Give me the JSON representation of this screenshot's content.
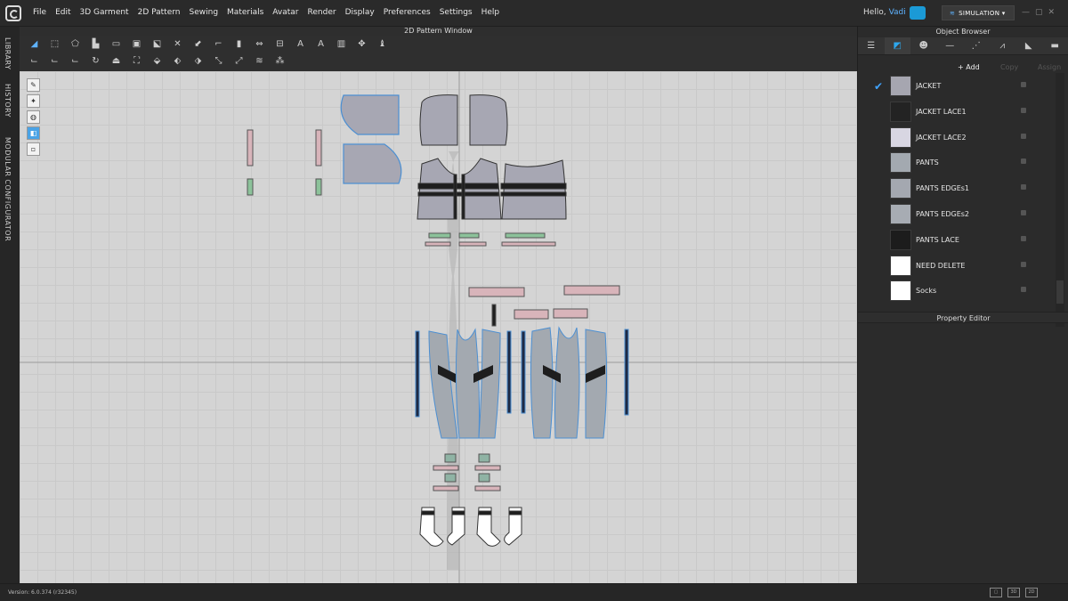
{
  "menubar": {
    "items": [
      "File",
      "Edit",
      "3D Garment",
      "2D Pattern",
      "Sewing",
      "Materials",
      "Avatar",
      "Render",
      "Display",
      "Preferences",
      "Settings",
      "Help"
    ],
    "greeting": "Hello,",
    "user": "Vadi",
    "mode_label": "SIMULATION",
    "window_controls": [
      "—",
      "▢",
      "✕"
    ]
  },
  "left_tabs": {
    "library": "LIBRARY",
    "history": "HISTORY",
    "modular": "MODULAR CONFIGURATOR"
  },
  "pattern_window": {
    "title": "2D Pattern Window"
  },
  "object_browser": {
    "title": "Object Browser",
    "tab_icons": [
      "list-icon",
      "fabric-icon",
      "avatar-icon",
      "line-icon",
      "dashed-line-icon",
      "stitch-icon",
      "texture-icon",
      "button-icon"
    ],
    "add_label": "+ Add",
    "copy_label": "Copy",
    "assign_label": "Assign",
    "materials": [
      {
        "name": "JACKET",
        "color": "#a6a6b0",
        "checked": true
      },
      {
        "name": "JACKET LACE1",
        "color": "#232323",
        "checked": false
      },
      {
        "name": "JACKET LACE2",
        "color": "#d8d6e2",
        "checked": false
      },
      {
        "name": "PANTS",
        "color": "#a3a9b0",
        "checked": false
      },
      {
        "name": "PANTS EDGEs1",
        "color": "#a4a8b0",
        "checked": false
      },
      {
        "name": "PANTS EDGEs2",
        "color": "#a7acb3",
        "checked": false
      },
      {
        "name": "PANTS LACE",
        "color": "#1c1c1c",
        "checked": false
      },
      {
        "name": "NEED DELETE",
        "color": "#ffffff",
        "checked": false
      },
      {
        "name": "Socks",
        "color": "#ffffff",
        "checked": false
      }
    ]
  },
  "property_editor": {
    "title": "Property Editor"
  },
  "status": {
    "version": "Version: 6.0.374 (r32345)"
  }
}
